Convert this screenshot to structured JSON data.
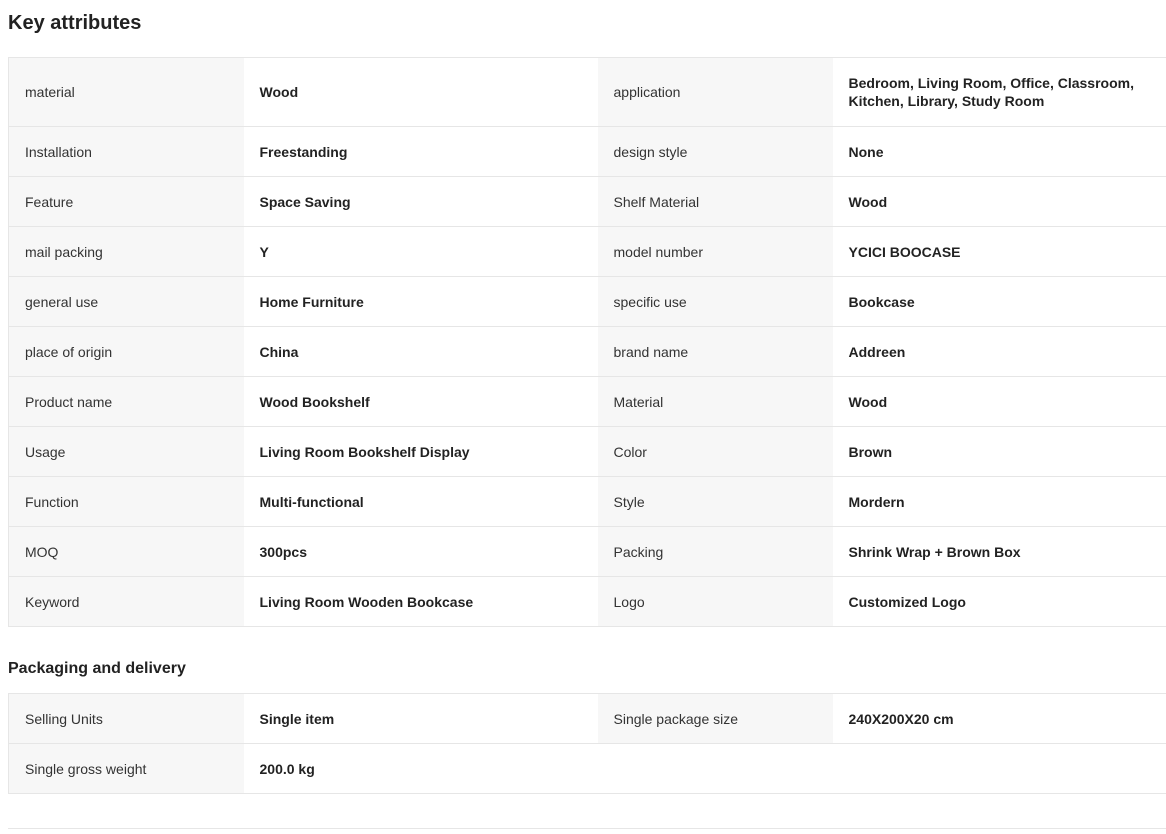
{
  "key_attributes": {
    "title": "Key attributes",
    "rows": [
      [
        {
          "label": "material",
          "value": "Wood"
        },
        {
          "label": "application",
          "value": "Bedroom, Living Room, Office, Classroom, Kitchen, Library, Study Room"
        }
      ],
      [
        {
          "label": "Installation",
          "value": "Freestanding"
        },
        {
          "label": "design style",
          "value": "None"
        }
      ],
      [
        {
          "label": "Feature",
          "value": "Space Saving"
        },
        {
          "label": "Shelf Material",
          "value": "Wood"
        }
      ],
      [
        {
          "label": "mail packing",
          "value": "Y"
        },
        {
          "label": "model number",
          "value": "YCICI BOOCASE"
        }
      ],
      [
        {
          "label": "general use",
          "value": "Home Furniture"
        },
        {
          "label": "specific use",
          "value": "Bookcase"
        }
      ],
      [
        {
          "label": "place of origin",
          "value": "China"
        },
        {
          "label": "brand name",
          "value": "Addreen"
        }
      ],
      [
        {
          "label": "Product name",
          "value": "Wood Bookshelf"
        },
        {
          "label": "Material",
          "value": "Wood"
        }
      ],
      [
        {
          "label": "Usage",
          "value": "Living Room Bookshelf Display"
        },
        {
          "label": "Color",
          "value": "Brown"
        }
      ],
      [
        {
          "label": "Function",
          "value": "Multi-functional"
        },
        {
          "label": "Style",
          "value": "Mordern"
        }
      ],
      [
        {
          "label": "MOQ",
          "value": "300pcs"
        },
        {
          "label": "Packing",
          "value": "Shrink Wrap + Brown Box"
        }
      ],
      [
        {
          "label": "Keyword",
          "value": "Living Room Wooden Bookcase"
        },
        {
          "label": "Logo",
          "value": "Customized Logo"
        }
      ]
    ]
  },
  "packaging": {
    "title": "Packaging and delivery",
    "rows": [
      [
        {
          "label": "Selling Units",
          "value": "Single item"
        },
        {
          "label": "Single package size",
          "value": "240X200X20 cm"
        }
      ],
      [
        {
          "label": "Single gross weight",
          "value": "200.0 kg"
        }
      ]
    ]
  }
}
